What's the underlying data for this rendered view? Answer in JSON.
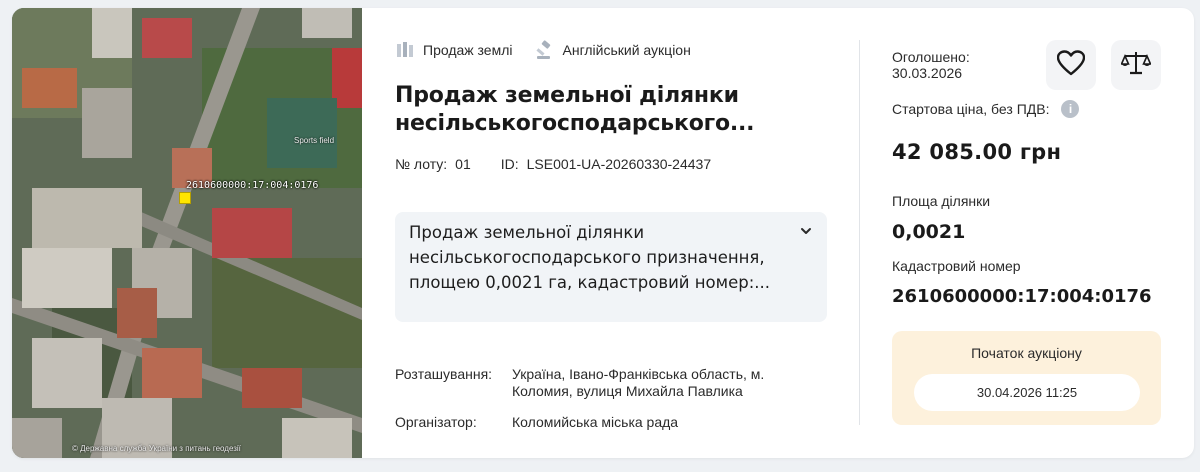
{
  "map": {
    "parcel_label": "2610600000:17:004:0176",
    "poi_label": "Sports field",
    "copyright": "© Державна служба України з питань геодезії"
  },
  "tags": {
    "category": "Продаж землі",
    "auction_type": "Англійський аукціон"
  },
  "title": "Продаж земельної ділянки несільськогосподарського...",
  "lot": {
    "number_label": "№ лоту:",
    "number": "01",
    "id_label": "ID:",
    "id": "LSE001-UA-20260330-24437"
  },
  "description": "Продаж земельної ділянки несільськогосподарського призначення, площею 0,0021 га, кадастровий номер:...",
  "info": {
    "location_label": "Розташування:",
    "location": "Україна, Івано-Франківська область, м. Коломия, вулиця Михайла Павлика",
    "organizer_label": "Організатор:",
    "organizer": "Коломийська міська рада"
  },
  "summary": {
    "announced_label": "Оголошено:",
    "announced_date": "30.03.2026",
    "price_label": "Стартова ціна, без ПДВ:",
    "price": "42 085.00 грн",
    "area_label": "Площа ділянки",
    "area": "0,0021",
    "cadastral_label": "Кадастровий номер",
    "cadastral": "2610600000:17:004:0176",
    "auction_start_label": "Початок аукціону",
    "auction_start": "30.04.2026 11:25"
  },
  "icons": {
    "category": "land-parcel-icon",
    "auction_type": "gavel-icon",
    "favorite": "heart-icon",
    "compare": "scales-icon",
    "info": "info-icon",
    "expand": "chevron-down-icon"
  },
  "colors": {
    "accent_bg": "#fdf1dc",
    "description_bg": "#f1f4f7",
    "parcel_highlight": "#ffe500"
  }
}
